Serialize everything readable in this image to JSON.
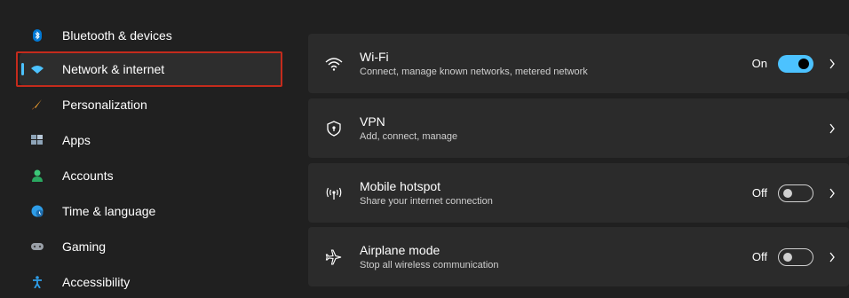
{
  "sidebar": {
    "items": [
      {
        "label": "Bluetooth & devices",
        "icon": "bluetooth-icon"
      },
      {
        "label": "Network & internet",
        "icon": "wifi-icon",
        "selected": true
      },
      {
        "label": "Personalization",
        "icon": "brush-icon"
      },
      {
        "label": "Apps",
        "icon": "apps-icon"
      },
      {
        "label": "Accounts",
        "icon": "person-icon"
      },
      {
        "label": "Time & language",
        "icon": "globe-clock-icon"
      },
      {
        "label": "Gaming",
        "icon": "gamepad-icon"
      },
      {
        "label": "Accessibility",
        "icon": "accessibility-icon"
      }
    ]
  },
  "cards": [
    {
      "title": "Wi-Fi",
      "desc": "Connect, manage known networks, metered network",
      "state": "On",
      "icon": "wifi-icon"
    },
    {
      "title": "VPN",
      "desc": "Add, connect, manage",
      "icon": "shield-icon"
    },
    {
      "title": "Mobile hotspot",
      "desc": "Share your internet connection",
      "state": "Off",
      "icon": "hotspot-icon"
    },
    {
      "title": "Airplane mode",
      "desc": "Stop all wireless communication",
      "state": "Off",
      "icon": "airplane-icon"
    }
  ],
  "colors": {
    "accent": "#4cc2ff",
    "highlight": "#c42b1c",
    "background": "#202020",
    "card": "#2b2b2b"
  }
}
